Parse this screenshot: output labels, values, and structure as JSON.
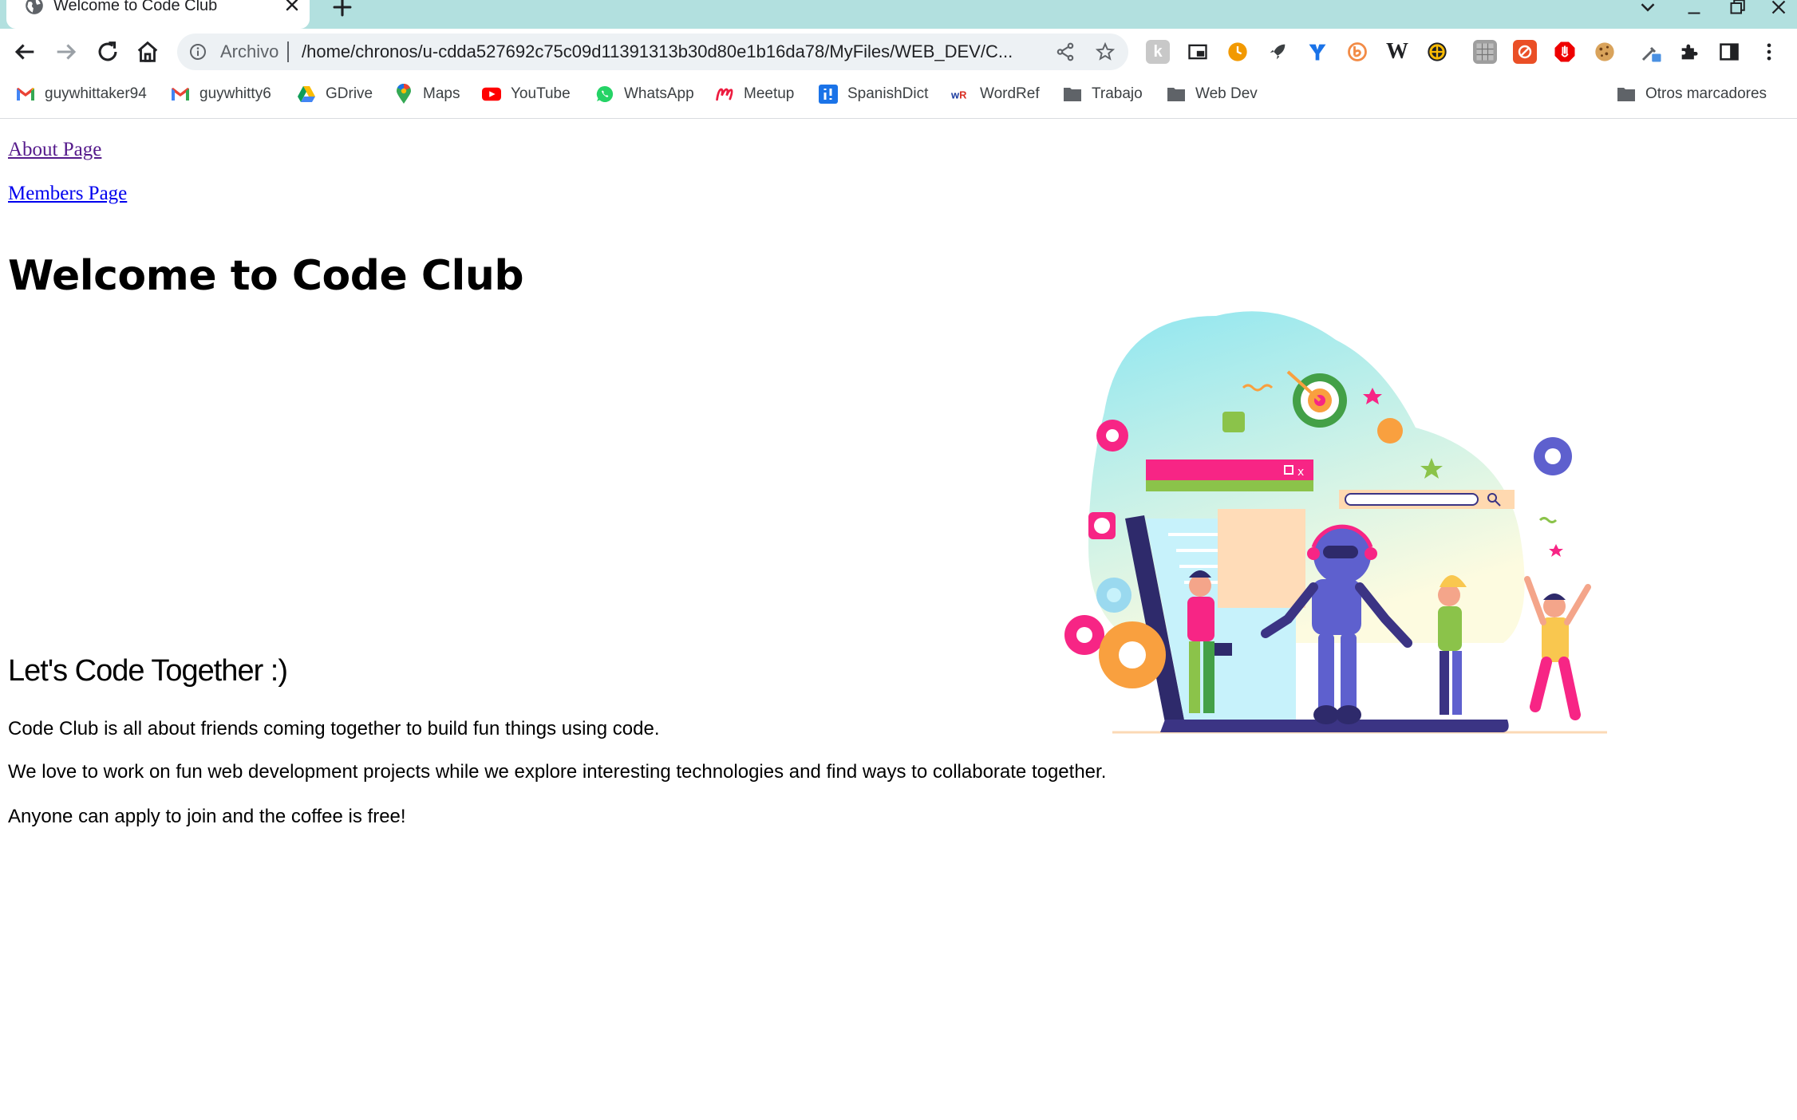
{
  "tab": {
    "title": "Welcome to Code Club"
  },
  "omnibox": {
    "scheme_label": "Archivo",
    "url": "/home/chronos/u-cdda527692c75c09d11391313b30d80e1b16da78/MyFiles/WEB_DEV/C..."
  },
  "bookmarks": [
    {
      "label": "guywhittaker94",
      "icon": "gmail-icon"
    },
    {
      "label": "guywhitty6",
      "icon": "gmail-icon"
    },
    {
      "label": "GDrive",
      "icon": "google-drive-icon"
    },
    {
      "label": "Maps",
      "icon": "google-maps-icon"
    },
    {
      "label": "YouTube",
      "icon": "youtube-icon"
    },
    {
      "label": "WhatsApp",
      "icon": "whatsapp-icon"
    },
    {
      "label": "Meetup",
      "icon": "meetup-icon"
    },
    {
      "label": "SpanishDict",
      "icon": "spanishdict-icon"
    },
    {
      "label": "WordRef",
      "icon": "wordreference-icon"
    },
    {
      "label": "Trabajo",
      "icon": "folder-icon"
    },
    {
      "label": "Web Dev",
      "icon": "folder-icon"
    }
  ],
  "other_bookmarks": {
    "label": "Otros marcadores",
    "icon": "folder-icon"
  },
  "extensions": {
    "wikipedia_letter": "W"
  },
  "page": {
    "links": {
      "about": "About Page",
      "members": "Members Page"
    },
    "heading": "Welcome to Code Club",
    "subheading": "Let's Code Together :)",
    "paragraphs": [
      "Code Club is all about friends coming together to build fun things using code.",
      "We love to work on fun web development projects while we explore interesting technologies and find ways to collaborate together.",
      "Anyone can apply to join and the coffee is free!"
    ]
  },
  "colors": {
    "tabstrip": "#b2e0df",
    "link_visited": "#551a8b",
    "link": "#0000ee",
    "omnibox_bg": "#edf1f4"
  }
}
